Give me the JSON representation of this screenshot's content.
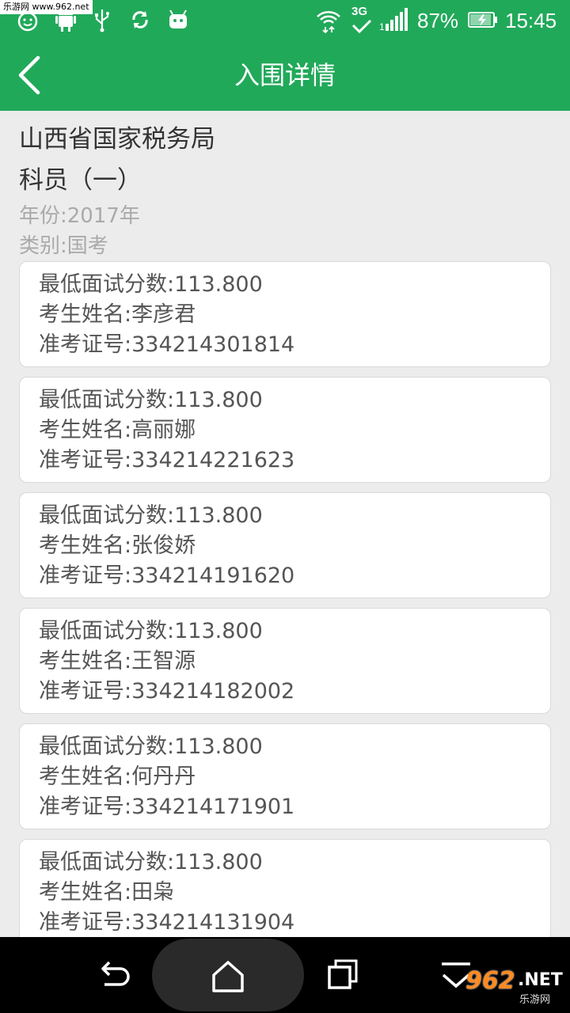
{
  "status_bar": {
    "watermark": "乐游网 www.962.net",
    "network": "3G",
    "battery": "87%",
    "time": "15:45",
    "icons": [
      "face-icon",
      "android-icon",
      "usb-icon",
      "sync-icon",
      "android-head-icon",
      "wifi-icon",
      "signal-icon",
      "battery-icon"
    ]
  },
  "header": {
    "title": "入围详情",
    "back_icon": "chevron-left-icon"
  },
  "info": {
    "org": "山西省国家税务局",
    "position": "科员（一）",
    "year": "年份:2017年",
    "category": "类别:国考"
  },
  "cards": [
    {
      "score": "最低面试分数:113.800",
      "name": "考生姓名:李彦君",
      "id": "准考证号:334214301814"
    },
    {
      "score": "最低面试分数:113.800",
      "name": "考生姓名:高丽娜",
      "id": "准考证号:334214221623"
    },
    {
      "score": "最低面试分数:113.800",
      "name": "考生姓名:张俊娇",
      "id": "准考证号:334214191620"
    },
    {
      "score": "最低面试分数:113.800",
      "name": "考生姓名:王智源",
      "id": "准考证号:334214182002"
    },
    {
      "score": "最低面试分数:113.800",
      "name": "考生姓名:何丹丹",
      "id": "准考证号:334214171901"
    },
    {
      "score": "最低面试分数:113.800",
      "name": "考生姓名:田枭",
      "id": "准考证号:334214131904"
    }
  ],
  "nav": {
    "icons": [
      "back-arrow-icon",
      "home-icon",
      "recents-icon",
      "menu-icon"
    ]
  },
  "watermark_bottom": {
    "logo": "962",
    "domain": ".NET",
    "sub": "乐游网"
  },
  "colors": {
    "primary": "#21a95a",
    "background": "#ececec",
    "card": "#ffffff",
    "muted_text": "#aaaaaa"
  }
}
